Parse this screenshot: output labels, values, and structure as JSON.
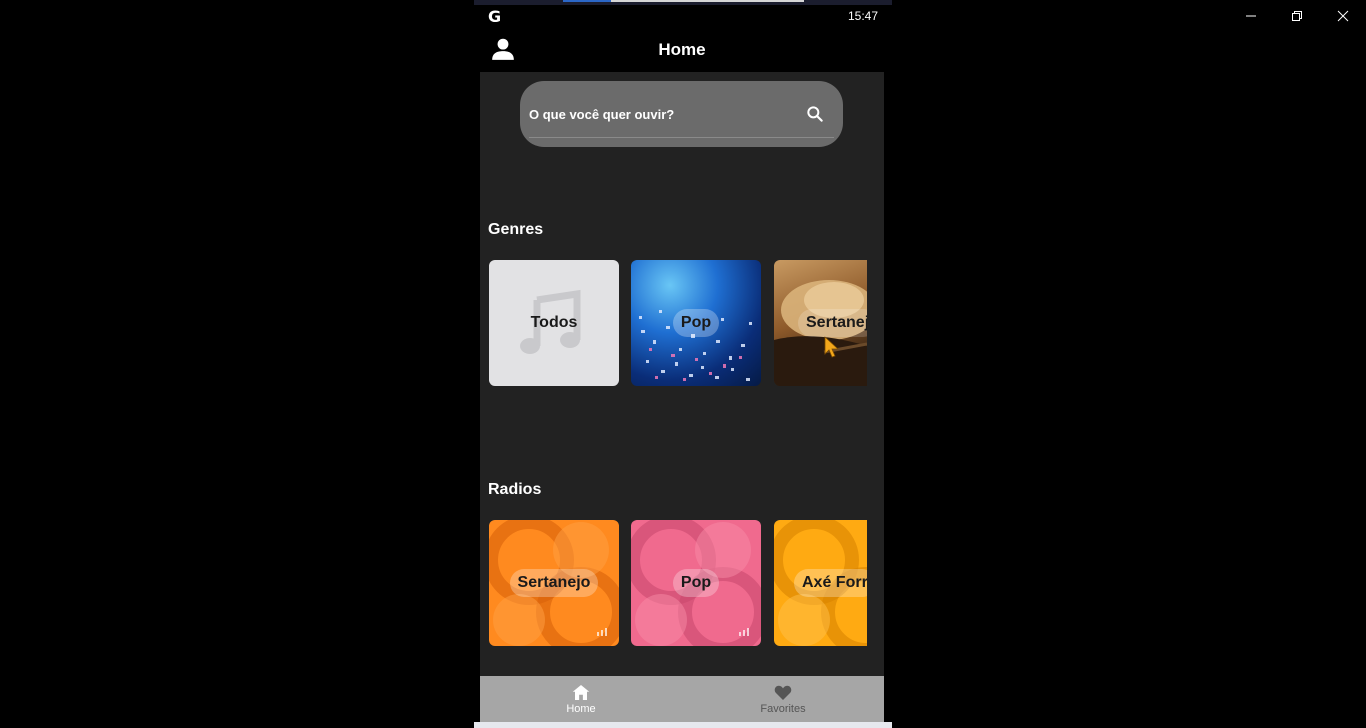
{
  "status_bar": {
    "app_glyph": "G",
    "time": "15:47"
  },
  "app_bar": {
    "title": "Home",
    "profile_icon": "person-icon"
  },
  "search": {
    "placeholder": "O que você quer ouvir?",
    "icon": "search-icon"
  },
  "genres": {
    "title": "Genres",
    "items": [
      {
        "label": "Todos",
        "icon": "music-note-icon"
      },
      {
        "label": "Pop"
      },
      {
        "label": "Sertanej"
      }
    ]
  },
  "radios": {
    "title": "Radios",
    "items": [
      {
        "label": "Sertanejo",
        "color": "#ff8a1f"
      },
      {
        "label": "Pop",
        "color": "#f06a8e"
      },
      {
        "label": "Axé Forr",
        "color": "#ffaa12"
      }
    ]
  },
  "bottom_nav": {
    "items": [
      {
        "label": "Home",
        "icon": "home-icon",
        "active": true
      },
      {
        "label": "Favorites",
        "icon": "heart-icon",
        "active": false
      }
    ]
  },
  "colors": {
    "background": "#222222",
    "search_bg": "#6b6b6b",
    "nav_bg": "#a6a6a6"
  }
}
